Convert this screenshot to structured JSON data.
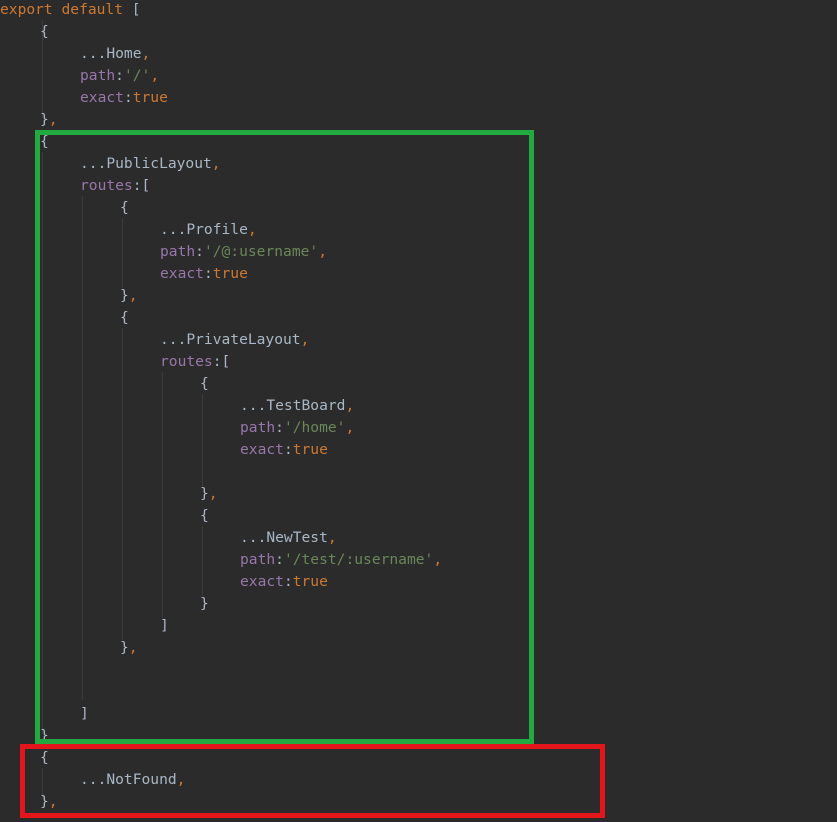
{
  "editor": {
    "colors": {
      "background": "#2b2b2b",
      "default": "#a9b7c6",
      "keyword": "#cc7832",
      "punct": "#cc7832",
      "string": "#6a8759",
      "property": "#9876aa",
      "guide": "#3c3c3c",
      "green_box": "#22a93f",
      "red_box": "#e3161c"
    },
    "lines": [
      {
        "indent": 0,
        "tokens": [
          {
            "t": "export default ",
            "c": "keyword"
          },
          {
            "t": "[",
            "c": "default"
          }
        ]
      },
      {
        "indent": 1,
        "tokens": [
          {
            "t": "{",
            "c": "default"
          }
        ]
      },
      {
        "indent": 2,
        "tokens": [
          {
            "t": "...Home",
            "c": "default"
          },
          {
            "t": ",",
            "c": "punct"
          }
        ]
      },
      {
        "indent": 2,
        "tokens": [
          {
            "t": "path",
            "c": "property"
          },
          {
            "t": ":",
            "c": "default"
          },
          {
            "t": "'/'",
            "c": "string"
          },
          {
            "t": ",",
            "c": "punct"
          }
        ]
      },
      {
        "indent": 2,
        "tokens": [
          {
            "t": "exact",
            "c": "property"
          },
          {
            "t": ":",
            "c": "default"
          },
          {
            "t": "true",
            "c": "keyword"
          }
        ]
      },
      {
        "indent": 1,
        "tokens": [
          {
            "t": "}",
            "c": "default"
          },
          {
            "t": ",",
            "c": "punct"
          }
        ]
      },
      {
        "indent": 1,
        "tokens": [
          {
            "t": "{",
            "c": "default"
          }
        ]
      },
      {
        "indent": 2,
        "tokens": [
          {
            "t": "...PublicLayout",
            "c": "default"
          },
          {
            "t": ",",
            "c": "punct"
          }
        ]
      },
      {
        "indent": 2,
        "tokens": [
          {
            "t": "routes",
            "c": "property"
          },
          {
            "t": ":[",
            "c": "default"
          }
        ]
      },
      {
        "indent": 3,
        "tokens": [
          {
            "t": "{",
            "c": "default"
          }
        ]
      },
      {
        "indent": 4,
        "tokens": [
          {
            "t": "...Profile",
            "c": "default"
          },
          {
            "t": ",",
            "c": "punct"
          }
        ]
      },
      {
        "indent": 4,
        "tokens": [
          {
            "t": "path",
            "c": "property"
          },
          {
            "t": ":",
            "c": "default"
          },
          {
            "t": "'/@:username'",
            "c": "string"
          },
          {
            "t": ",",
            "c": "punct"
          }
        ]
      },
      {
        "indent": 4,
        "tokens": [
          {
            "t": "exact",
            "c": "property"
          },
          {
            "t": ":",
            "c": "default"
          },
          {
            "t": "true",
            "c": "keyword"
          }
        ]
      },
      {
        "indent": 3,
        "tokens": [
          {
            "t": "}",
            "c": "default"
          },
          {
            "t": ",",
            "c": "punct"
          }
        ]
      },
      {
        "indent": 3,
        "tokens": [
          {
            "t": "{",
            "c": "default"
          }
        ]
      },
      {
        "indent": 4,
        "tokens": [
          {
            "t": "...PrivateLayout",
            "c": "default"
          },
          {
            "t": ",",
            "c": "punct"
          }
        ]
      },
      {
        "indent": 4,
        "tokens": [
          {
            "t": "routes",
            "c": "property"
          },
          {
            "t": ":[",
            "c": "default"
          }
        ]
      },
      {
        "indent": 5,
        "tokens": [
          {
            "t": "{",
            "c": "default"
          }
        ]
      },
      {
        "indent": 6,
        "tokens": [
          {
            "t": "...TestBoard",
            "c": "default"
          },
          {
            "t": ",",
            "c": "punct"
          }
        ]
      },
      {
        "indent": 6,
        "tokens": [
          {
            "t": "path",
            "c": "property"
          },
          {
            "t": ":",
            "c": "default"
          },
          {
            "t": "'/home'",
            "c": "string"
          },
          {
            "t": ",",
            "c": "punct"
          }
        ]
      },
      {
        "indent": 6,
        "tokens": [
          {
            "t": "exact",
            "c": "property"
          },
          {
            "t": ":",
            "c": "default"
          },
          {
            "t": "true",
            "c": "keyword"
          }
        ]
      },
      {
        "indent": 0,
        "tokens": []
      },
      {
        "indent": 5,
        "tokens": [
          {
            "t": "}",
            "c": "default"
          },
          {
            "t": ",",
            "c": "punct"
          }
        ]
      },
      {
        "indent": 5,
        "tokens": [
          {
            "t": "{",
            "c": "default"
          }
        ]
      },
      {
        "indent": 6,
        "tokens": [
          {
            "t": "...NewTest",
            "c": "default"
          },
          {
            "t": ",",
            "c": "punct"
          }
        ]
      },
      {
        "indent": 6,
        "tokens": [
          {
            "t": "path",
            "c": "property"
          },
          {
            "t": ":",
            "c": "default"
          },
          {
            "t": "'/test/:username'",
            "c": "string"
          },
          {
            "t": ",",
            "c": "punct"
          }
        ]
      },
      {
        "indent": 6,
        "tokens": [
          {
            "t": "exact",
            "c": "property"
          },
          {
            "t": ":",
            "c": "default"
          },
          {
            "t": "true",
            "c": "keyword"
          }
        ]
      },
      {
        "indent": 5,
        "tokens": [
          {
            "t": "}",
            "c": "default"
          }
        ]
      },
      {
        "indent": 4,
        "tokens": [
          {
            "t": "]",
            "c": "default"
          }
        ]
      },
      {
        "indent": 3,
        "tokens": [
          {
            "t": "}",
            "c": "default"
          },
          {
            "t": ",",
            "c": "punct"
          }
        ]
      },
      {
        "indent": 0,
        "tokens": []
      },
      {
        "indent": 0,
        "tokens": []
      },
      {
        "indent": 2,
        "tokens": [
          {
            "t": "]",
            "c": "default"
          }
        ]
      },
      {
        "indent": 1,
        "tokens": [
          {
            "t": "}",
            "c": "default"
          }
        ]
      },
      {
        "indent": 1,
        "tokens": [
          {
            "t": "{",
            "c": "default"
          }
        ]
      },
      {
        "indent": 2,
        "tokens": [
          {
            "t": "...NotFound",
            "c": "default"
          },
          {
            "t": ",",
            "c": "punct"
          }
        ]
      },
      {
        "indent": 1,
        "tokens": [
          {
            "t": "}",
            "c": "default"
          },
          {
            "t": ",",
            "c": "punct"
          }
        ]
      }
    ]
  },
  "annotations": [
    {
      "name": "green-highlight-box",
      "color": "green_box"
    },
    {
      "name": "red-highlight-box",
      "color": "red_box"
    }
  ]
}
